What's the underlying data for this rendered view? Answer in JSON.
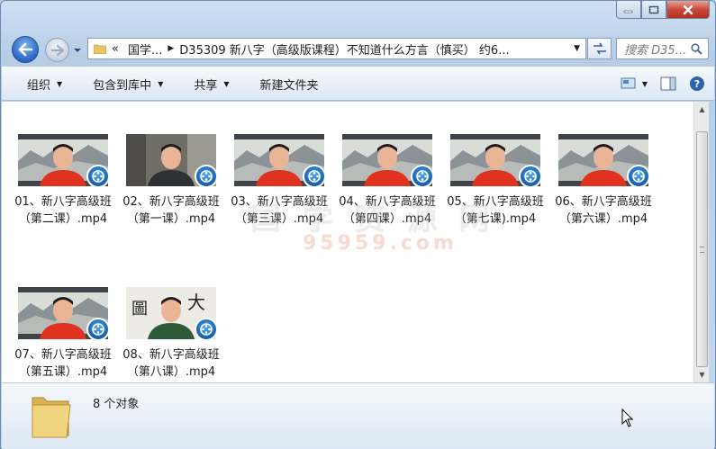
{
  "address": {
    "breadcrumbs": [
      "国学...",
      "D35309 新八字（高级版课程）不知道什么方言（慎买） 约6..."
    ],
    "back_icon": "back-arrow-icon",
    "forward_icon": "forward-arrow-icon"
  },
  "search": {
    "placeholder": "搜索 D35..."
  },
  "toolbar": {
    "organize": "组织",
    "include_library": "包含到库中",
    "share": "共享",
    "new_folder": "新建文件夹"
  },
  "files": [
    {
      "line1": "01、新八字高级班",
      "line2": "（第二课）.mp4",
      "scene": "red"
    },
    {
      "line1": "02、新八字高级班",
      "line2": "（第一课）.mp4",
      "scene": "dark"
    },
    {
      "line1": "03、新八字高级班",
      "line2": "（第三课）.mp4",
      "scene": "red"
    },
    {
      "line1": "04、新八字高级班",
      "line2": "（第四课）.mp4",
      "scene": "red"
    },
    {
      "line1": "05、新八字高级班",
      "line2": "（第七课).mp4",
      "scene": "red"
    },
    {
      "line1": "06、新八字高级班",
      "line2": "（第六课）.mp4",
      "scene": "red"
    },
    {
      "line1": "07、新八字高级班",
      "line2": "（第五课）.mp4",
      "scene": "red"
    },
    {
      "line1": "08、新八字高级班",
      "line2": "（第八课）.mp4",
      "scene": "green"
    }
  ],
  "watermark": {
    "text": "国 学 资 源 网",
    "url": "95959.com"
  },
  "details": {
    "count": "8 个对象"
  },
  "colors": {
    "accent": "#2a66c4",
    "window_bg": "#c5d8ee",
    "shirt_red": "#e0321f"
  }
}
